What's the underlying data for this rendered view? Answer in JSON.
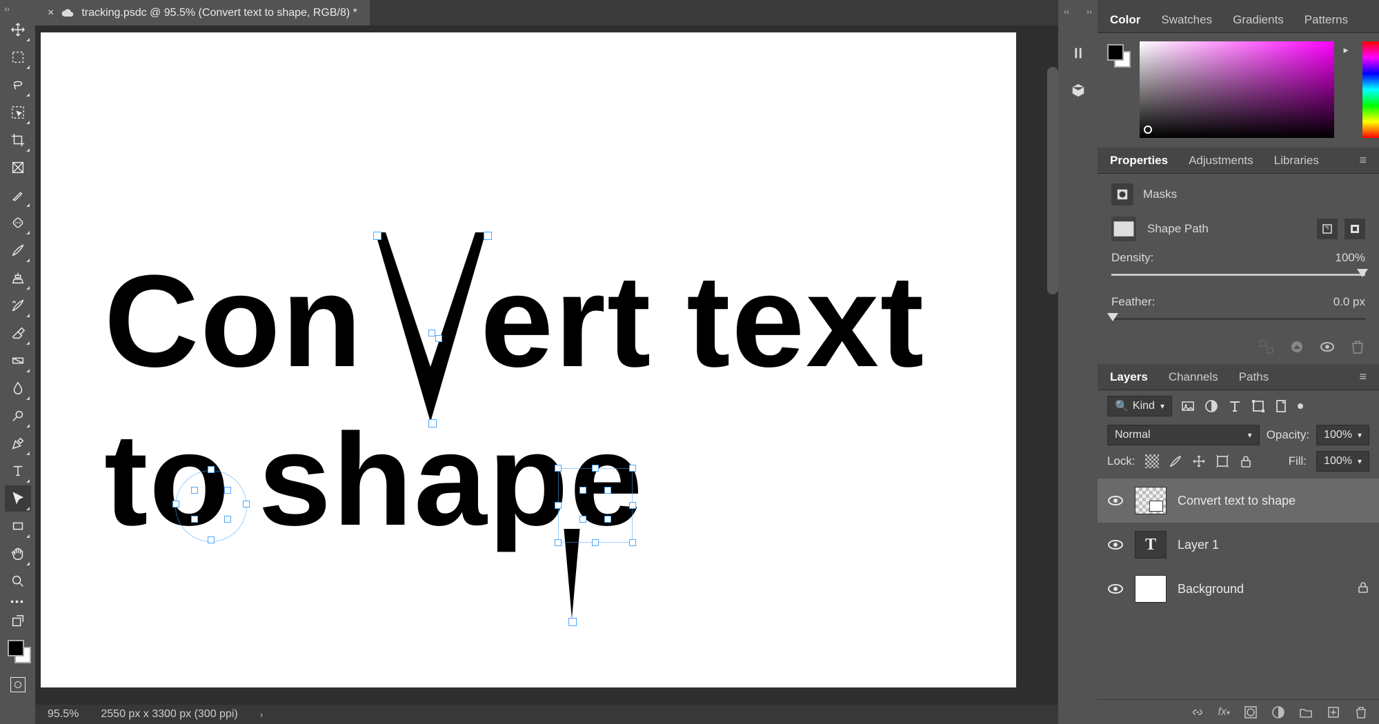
{
  "document": {
    "tab_close_glyph": "×",
    "tab_title": "tracking.psdc @ 95.5% (Convert text to shape, RGB/8) *"
  },
  "canvas": {
    "line1_part_a": "Con",
    "line1_part_b": "ert",
    "line1_part_c": "text",
    "line2_part_a": "to",
    "line2_part_b": "shape"
  },
  "statusbar": {
    "zoom": "95.5%",
    "doc_info": "2550 px x 3300 px (300 ppi)",
    "chev": "›"
  },
  "panels": {
    "color": {
      "tabs": [
        "Color",
        "Swatches",
        "Gradients",
        "Patterns"
      ],
      "active": "Color"
    },
    "properties": {
      "tabs": [
        "Properties",
        "Adjustments",
        "Libraries"
      ],
      "active": "Properties",
      "masks_label": "Masks",
      "shape_path_label": "Shape Path",
      "density_label": "Density:",
      "density_value": "100%",
      "feather_label": "Feather:",
      "feather_value": "0.0 px"
    },
    "layers": {
      "tabs": [
        "Layers",
        "Channels",
        "Paths"
      ],
      "active": "Layers",
      "filter_kind_prefix": "🔍",
      "filter_kind_label": "Kind",
      "blend_mode": "Normal",
      "opacity_label": "Opacity:",
      "opacity_value": "100%",
      "lock_label": "Lock:",
      "fill_label": "Fill:",
      "fill_value": "100%",
      "items": [
        {
          "name": "Convert text to shape",
          "kind": "shape",
          "selected": true
        },
        {
          "name": "Layer 1",
          "kind": "text",
          "selected": false
        },
        {
          "name": "Background",
          "kind": "bg",
          "locked": true,
          "selected": false
        }
      ]
    }
  },
  "tools": [
    "move",
    "marquee",
    "lasso",
    "object-select",
    "crop",
    "frame",
    "eyedropper",
    "spot-heal",
    "brush",
    "clone-stamp",
    "history-brush",
    "eraser",
    "gradient",
    "blur",
    "dodge",
    "pen",
    "type",
    "path-select",
    "rectangle",
    "hand",
    "zoom"
  ],
  "selected_tool_index": 17
}
